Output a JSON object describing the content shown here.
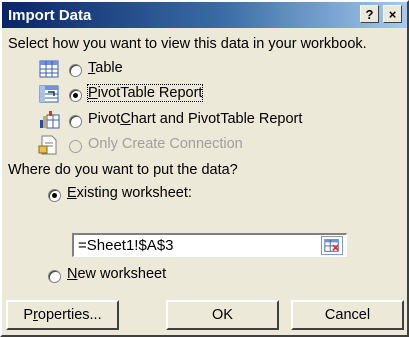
{
  "window": {
    "title": "Import Data",
    "help": "?",
    "close": "×"
  },
  "view_prompt": "Select how you want to view this data in your workbook.",
  "view_options": [
    {
      "pre": "",
      "key": "T",
      "post": "able",
      "checked": false,
      "disabled": false,
      "icon": "table-icon"
    },
    {
      "pre": "",
      "key": "P",
      "post": "ivotTable Report",
      "checked": true,
      "disabled": false,
      "icon": "pivottable-icon"
    },
    {
      "pre": "Pivot",
      "key": "C",
      "post": "hart and PivotTable Report",
      "checked": false,
      "disabled": false,
      "icon": "pivotchart-icon"
    },
    {
      "pre": "",
      "key": "",
      "post": "Only Create Connection",
      "checked": false,
      "disabled": true,
      "icon": "connection-icon"
    }
  ],
  "location_prompt": "Where do you want to put the data?",
  "existing": {
    "key": "E",
    "post": "xisting worksheet:",
    "checked": true
  },
  "range_value": "=Sheet1!$A$3",
  "new_ws": {
    "key": "N",
    "post": "ew worksheet",
    "checked": false
  },
  "buttons": {
    "properties_pre": "P",
    "properties_key": "r",
    "properties_post": "operties...",
    "ok": "OK",
    "cancel": "Cancel"
  }
}
